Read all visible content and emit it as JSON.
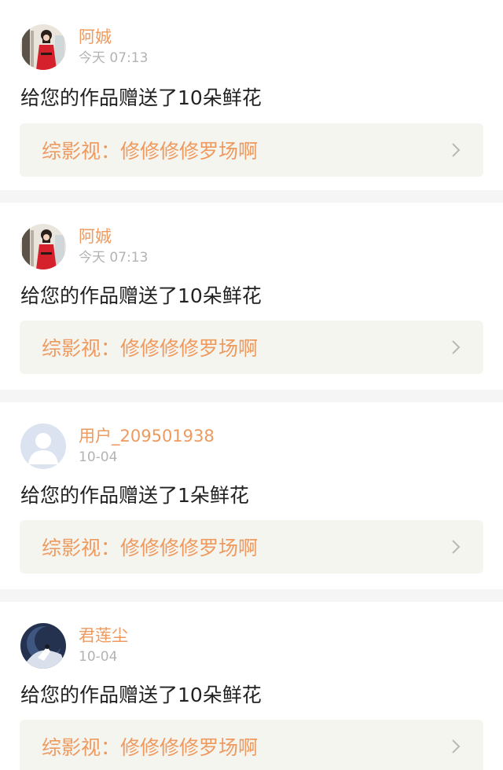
{
  "notifications": [
    {
      "avatar_icon": "avatar-photo-red-dress-icon",
      "username": "阿娍",
      "time": "今天 07:13",
      "message": "给您的作品赠送了10朵鲜花",
      "work_title": "综影视：修修修修罗场啊"
    },
    {
      "avatar_icon": "avatar-photo-red-dress-icon",
      "username": "阿娍",
      "time": "今天 07:13",
      "message": "给您的作品赠送了10朵鲜花",
      "work_title": "综影视：修修修修罗场啊"
    },
    {
      "avatar_icon": "default-user-avatar-icon",
      "username": "用户_209501938",
      "time": "10-04",
      "message": "给您的作品赠送了1朵鲜花",
      "work_title": "综影视：修修修修罗场啊"
    },
    {
      "avatar_icon": "avatar-illustration-moon-icon",
      "username": "君莲尘",
      "time": "10-04",
      "message": "给您的作品赠送了10朵鲜花",
      "work_title": "综影视：修修修修罗场啊"
    }
  ],
  "colors": {
    "accent": "#ee9a5f",
    "time": "#b3b3b3",
    "message": "#222222",
    "work_bg": "#f5f5f0",
    "page_bg": "#f5f5f5"
  }
}
